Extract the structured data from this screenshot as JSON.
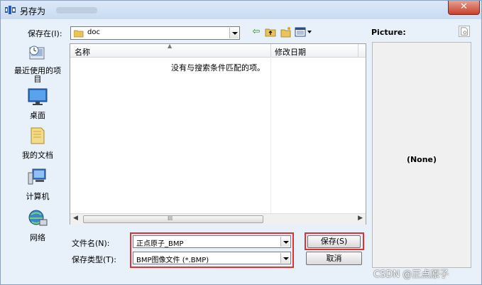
{
  "window": {
    "title": "另存为",
    "close_label": "✕"
  },
  "location": {
    "label": "保存在(I):",
    "value": "doc"
  },
  "places": [
    {
      "label": "最近使用的项目",
      "icon": "recent-items-icon"
    },
    {
      "label": "桌面",
      "icon": "desktop-icon"
    },
    {
      "label": "我的文档",
      "icon": "documents-icon"
    },
    {
      "label": "计算机",
      "icon": "computer-icon"
    },
    {
      "label": "网络",
      "icon": "network-icon"
    }
  ],
  "file_list": {
    "columns": [
      "名称",
      "修改日期"
    ],
    "empty_message": "没有与搜索条件匹配的项。",
    "scrollbar_grip": "III"
  },
  "filename": {
    "label": "文件名(N):",
    "value": "正点原子_BMP"
  },
  "filetype": {
    "label": "保存类型(T):",
    "value": "BMP图像文件 (*.BMP)"
  },
  "buttons": {
    "save": "保存(S)",
    "cancel": "取消"
  },
  "preview": {
    "title": "Picture:",
    "placeholder": "(None)"
  },
  "watermark": "CSDN @正点原子",
  "colors": {
    "highlight_border": "#e03030",
    "title_gradient_top": "#dbe8f8",
    "close_button": "#c7402c"
  }
}
